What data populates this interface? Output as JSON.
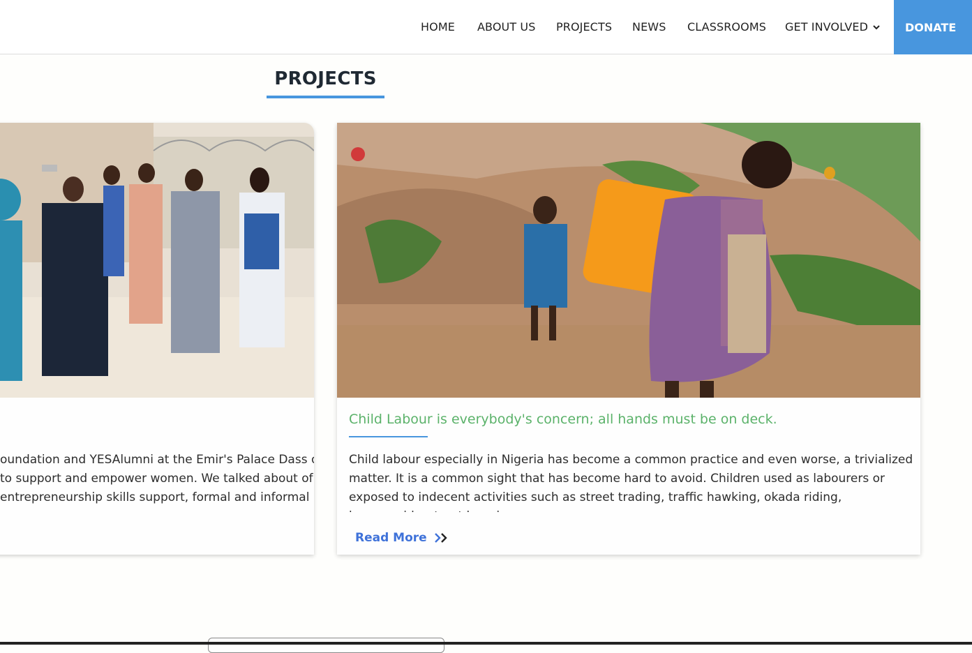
{
  "nav": {
    "items": [
      "HOME",
      "ABOUT US",
      "PROJECTS",
      "NEWS",
      "CLASSROOMS"
    ],
    "get_involved": "GET INVOLVED",
    "donate": "DONATE"
  },
  "section": {
    "title": "PROJECTS"
  },
  "cards": [
    {
      "title": "",
      "text": "oundation and YESAlumni at the Emir's Palace Dass on to support and empower women. We talked about of entrepreneurship skills support, formal and informal",
      "read_more": ""
    },
    {
      "title": "Child Labour is everybody's concern; all hands must be on deck.",
      "text": "Child labour especially in Nigeria has become a common practice and even worse, a trivialized matter. It is a common sight that has become hard to avoid. Children used as labourers or exposed to indecent activities such as street trading, traffic hawking, okada riding, housemaids, street begging",
      "read_more": "Read More"
    }
  ],
  "colors": {
    "accent": "#4896de",
    "title_green": "#5bb26a",
    "link_blue": "#3f72d9"
  }
}
